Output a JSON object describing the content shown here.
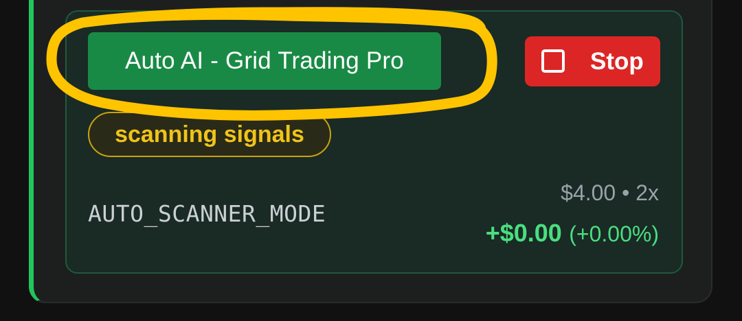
{
  "card": {
    "strategy_name": "Auto AI - Grid Trading Pro",
    "status": "scanning signals",
    "mode": "AUTO_SCANNER_MODE",
    "amount": "$4.00",
    "separator": "•",
    "leverage": "2x",
    "pnl_value": "+$0.00",
    "pnl_percent": "(+0.00%)"
  },
  "stop_button": {
    "label": "Stop",
    "icon": "stop-square-icon"
  },
  "colors": {
    "accent_green": "#22c55e",
    "badge_green": "#198a45",
    "stop_red": "#dc2626",
    "status_yellow": "#f0c419",
    "pnl_green": "#4ade80",
    "highlight_yellow": "#ffc400"
  }
}
